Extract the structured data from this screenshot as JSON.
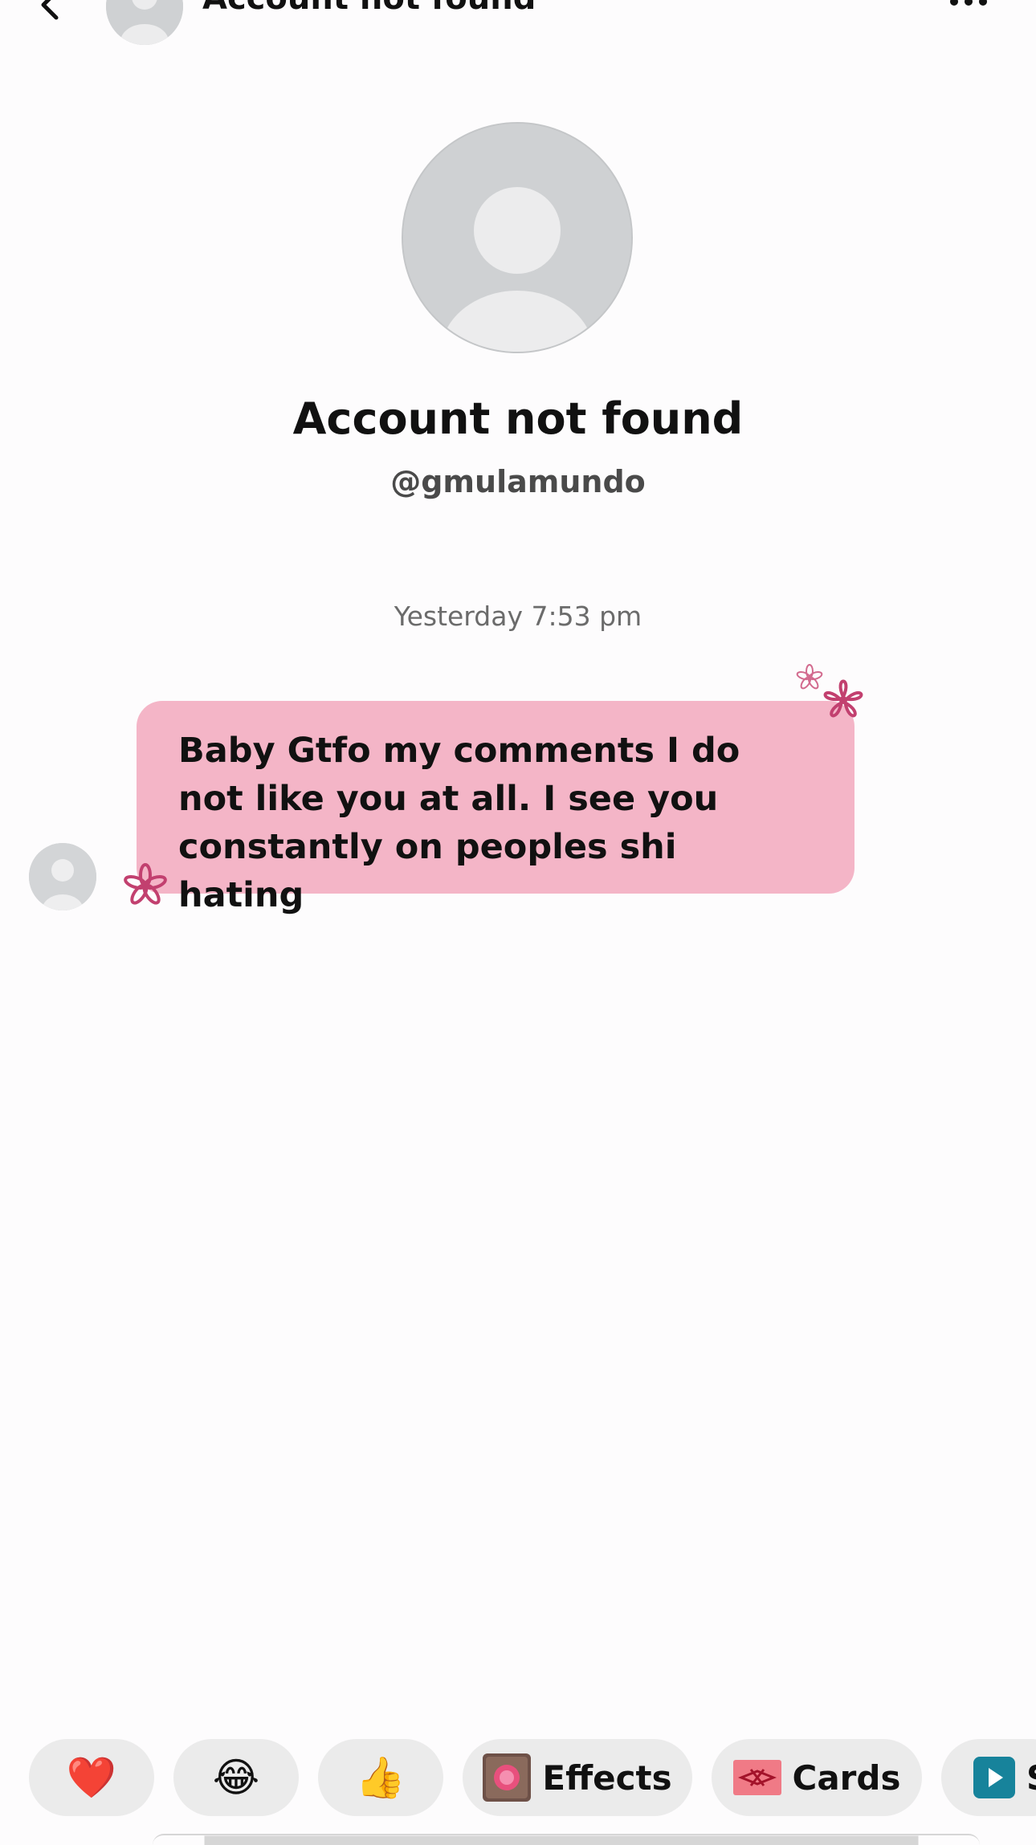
{
  "header": {
    "title": "Account not found",
    "back_icon": "chevron-left-icon",
    "more_icon": "more-horizontal-icon"
  },
  "profile": {
    "name": "Account not found",
    "handle": "@gmulamundo"
  },
  "conversation": {
    "timestamp": "Yesterday 7:53 pm",
    "messages": [
      {
        "text": "Baby Gtfo my comments I do not like you at all. I see you constantly on peoples shi hating",
        "bubble_color": "#f4b5c7"
      }
    ]
  },
  "quick_bar": {
    "reactions": [
      "❤️",
      "😂",
      "👍"
    ],
    "effects_label": "Effects",
    "cards_label": "Cards",
    "third_label": "S"
  },
  "colors": {
    "bubble": "#f4b5c7",
    "flower": "#c2406f",
    "chip_bg": "#ebebeb",
    "avatar_placeholder": "#d0d2d4"
  }
}
